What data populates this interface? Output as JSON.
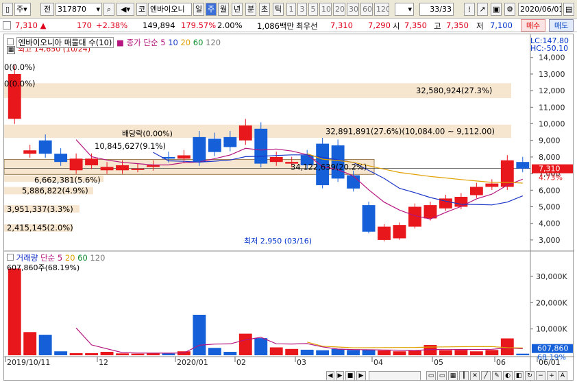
{
  "toolbar": {
    "type_label": "주",
    "prev_label": "전",
    "code": "317870",
    "market_label": "코",
    "stock_name": "엔바이오니",
    "period_day": "일",
    "period_week": "주",
    "period_month": "월",
    "period_year": "년",
    "period_min": "분",
    "period_sec": "초",
    "period_tick": "틱",
    "intervals": [
      "1",
      "3",
      "5",
      "10",
      "20",
      "30",
      "60",
      "120"
    ],
    "page_counter": "33/33",
    "date": "2020/06/01"
  },
  "quote": {
    "price": "7,310",
    "arrow": "▲",
    "change": "170",
    "change_pct": "+2.38%",
    "volume": "149,894",
    "volume_ratio": "179.57%",
    "turnover_pct": "2.00%",
    "amount": "1,086백만",
    "best_label": "최우선",
    "best_ask": "7,310",
    "best_bid": "7,290",
    "open_label": "시",
    "open": "7,350",
    "high_label": "고",
    "high": "7,350",
    "low_label": "저",
    "low": "7,100",
    "buy_label": "매수",
    "sell_label": "매도"
  },
  "price_panel": {
    "title": "엔바이오니아 매물대 수(10)",
    "ma_label": "종가 단순",
    "ma_periods": [
      "5",
      "10",
      "20",
      "60",
      "120"
    ],
    "lc": "LC:147.80",
    "hc": "HC:-50.10",
    "high_note": "최고 14,650 (10/24)",
    "low_note": "최저 2,950 (03/16)",
    "dividend_note": "배당락(0.00%)",
    "current_price_tag": "7,310",
    "current_pct_tag": "4.73%",
    "y_ticks": [
      "14,000",
      "13,000",
      "12,000",
      "11,000",
      "10,000",
      "9,000",
      "8,000",
      "7,000",
      "6,000",
      "5,000",
      "4,000",
      "3,000"
    ],
    "profile_labels": [
      "32,580,924(27.3%)",
      "0(0.0%)",
      "0(0.0%)",
      "32,891,891(27.6%)(10,084.00 ~ 9,112.00)",
      "10,845,627(9.1%)",
      "34,122,639(20.2%)",
      "6,662,381(5.6%)",
      "5,886,822(4.9%)",
      "3,951,337(3.3%)",
      "2,415,145(2.0%)"
    ]
  },
  "volume_panel": {
    "title": "거래량",
    "ma_label": "단순",
    "ma_periods": [
      "5",
      "20",
      "60",
      "120"
    ],
    "max_note": "607,860주(68.19%)",
    "y_ticks": [
      "30,000K",
      "20,000K",
      "10,000K"
    ],
    "current_tag": "607,860",
    "current_pct": "68.19%"
  },
  "x_axis": [
    "2019/10/11",
    "12",
    "2020/01",
    "02",
    "03",
    "04",
    "05",
    "06",
    "06/01"
  ],
  "chart_data": {
    "type": "candlestick",
    "x": [
      "2019-10-11",
      "2019-10-18",
      "2019-10-25",
      "2019-11-01",
      "2019-11-08",
      "2019-11-15",
      "2019-11-22",
      "2019-11-29",
      "2019-12-06",
      "2019-12-13",
      "2019-12-20",
      "2019-12-27",
      "2020-01-03",
      "2020-01-10",
      "2020-01-17",
      "2020-01-24",
      "2020-01-31",
      "2020-02-07",
      "2020-02-14",
      "2020-02-21",
      "2020-02-28",
      "2020-03-06",
      "2020-03-13",
      "2020-03-20",
      "2020-03-27",
      "2020-04-03",
      "2020-04-10",
      "2020-04-17",
      "2020-04-24",
      "2020-05-01",
      "2020-05-08",
      "2020-05-15",
      "2020-05-22",
      "2020-05-29"
    ],
    "open": [
      10300,
      8200,
      9000,
      8200,
      7200,
      7500,
      7200,
      7200,
      7300,
      7400,
      8000,
      7900,
      9200,
      9100,
      9200,
      9000,
      9700,
      7700,
      7600,
      8100,
      8800,
      8700,
      6900,
      5100,
      3000,
      3100,
      3800,
      4300,
      4900,
      5000,
      5700,
      6200,
      6200,
      7700
    ],
    "close": [
      13000,
      8400,
      8200,
      7700,
      7900,
      7900,
      7400,
      7500,
      7300,
      7500,
      7900,
      8100,
      7700,
      8300,
      8600,
      9900,
      7600,
      8000,
      7700,
      7500,
      6300,
      6700,
      6100,
      3500,
      3800,
      3900,
      5000,
      5100,
      5500,
      5600,
      6200,
      6400,
      7800,
      7300
    ],
    "volume_k": [
      33000,
      8800,
      7800,
      1500,
      800,
      800,
      1300,
      700,
      600,
      800,
      700,
      1500,
      15400,
      2800,
      1300,
      8200,
      6500,
      3000,
      2400,
      2100,
      1900,
      2400,
      2000,
      2000,
      1800,
      1500,
      1700,
      3900,
      1900,
      2000,
      1500,
      2000,
      6400,
      600
    ],
    "price_ylim": [
      2500,
      14650
    ],
    "volume_ylim": [
      0,
      36000
    ]
  }
}
